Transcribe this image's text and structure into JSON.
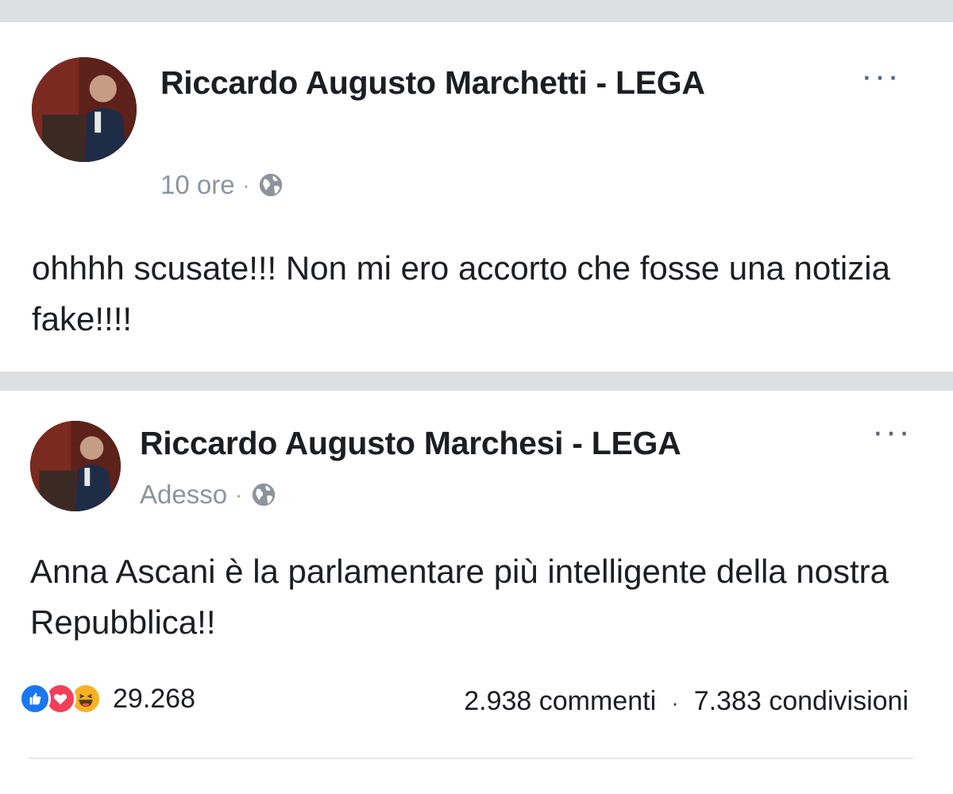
{
  "posts": [
    {
      "author": "Riccardo Augusto Marchetti - LEGA",
      "time": "10 ore",
      "separator": "·",
      "text": "ohhhh scusate!!! Non mi ero accorto che fosse una notizia fake!!!!",
      "privacy_icon": "globe-icon",
      "menu_icon": "more-icon",
      "menu_label": "···"
    },
    {
      "author": "Riccardo Augusto Marchesi - LEGA",
      "time": "Adesso",
      "separator": "·",
      "text": "Anna Ascani è la parlamentare più intelligente della nostra Repubblica!!",
      "privacy_icon": "globe-icon",
      "menu_icon": "more-icon",
      "menu_label": "···",
      "reactions": {
        "icons": [
          "like-icon",
          "love-icon",
          "haha-icon"
        ],
        "count": "29.268"
      },
      "comments": "2.938 commenti",
      "shares": "7.383 condivisioni",
      "stats_separator": "·"
    }
  ],
  "colors": {
    "background": "#dddfe3",
    "card": "#ffffff",
    "meta_text": "#8d949e",
    "like": "#1877f2",
    "love": "#f33e58",
    "haha": "#f7b125"
  }
}
